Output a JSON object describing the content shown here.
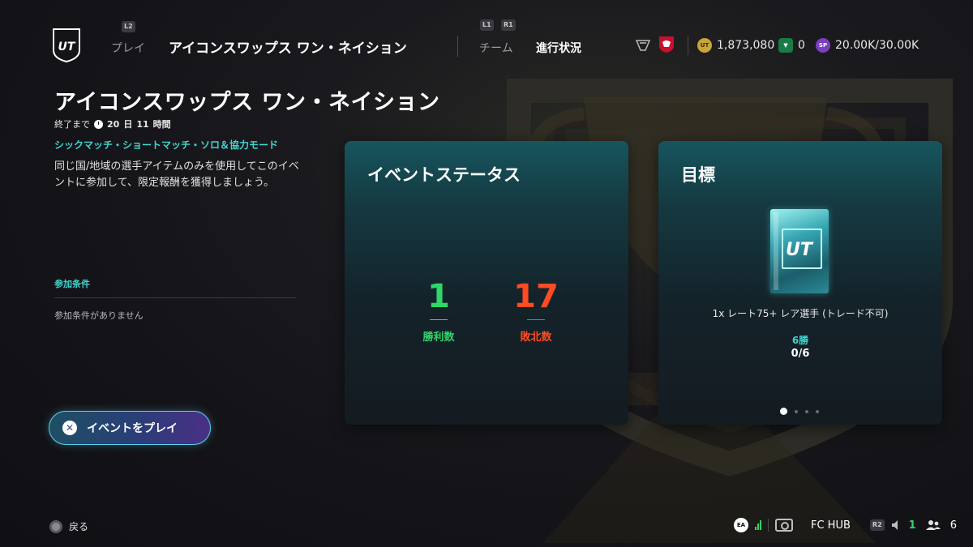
{
  "header": {
    "logo_text": "UT",
    "hint_l2": "L2",
    "nav_play": "プレイ",
    "nav_title": "アイコンスワップス ワン・ネイション",
    "hint_l1": "L1",
    "hint_r1": "R1",
    "nav_team": "チーム",
    "nav_progress": "進行状況",
    "coins": "1,873,080",
    "fc_points": "0",
    "sp_label": "SP",
    "sp_value": "20.00K/30.00K"
  },
  "event": {
    "title": "アイコンスワップス ワン・ネイション",
    "ends_prefix": "終了まで",
    "ends_days": "20",
    "days_unit": "日",
    "ends_hours": "11",
    "hours_unit": "時間",
    "modes": "シックマッチ・ショートマッチ・ソロ＆協力モード",
    "description": "同じ国/地域の選手アイテムのみを使用してこのイベントに参加して、限定報酬を獲得しましょう。",
    "requirements_heading": "参加条件",
    "requirements_text": "参加条件がありません",
    "play_button": "イベントをプレイ"
  },
  "status_card": {
    "title": "イベントステータス",
    "wins": "1",
    "wins_label": "勝利数",
    "losses": "17",
    "losses_label": "敗北数"
  },
  "objective_card": {
    "title": "目標",
    "pack_text": "UT",
    "reward": "1x レート75+ レア選手 (トレード不可)",
    "wins_required": "6勝",
    "progress": "0/6",
    "page_count": 4,
    "active_page": 1
  },
  "footer": {
    "back_label": "戻る",
    "ea_label": "EA",
    "hub_label": "FC HUB",
    "r2_hint": "R2",
    "voice_count": "1",
    "friends_count": "6"
  },
  "colors": {
    "accent_teal": "#3fd6d2",
    "wins_green": "#2fd66a",
    "losses_red": "#ff4a22"
  }
}
